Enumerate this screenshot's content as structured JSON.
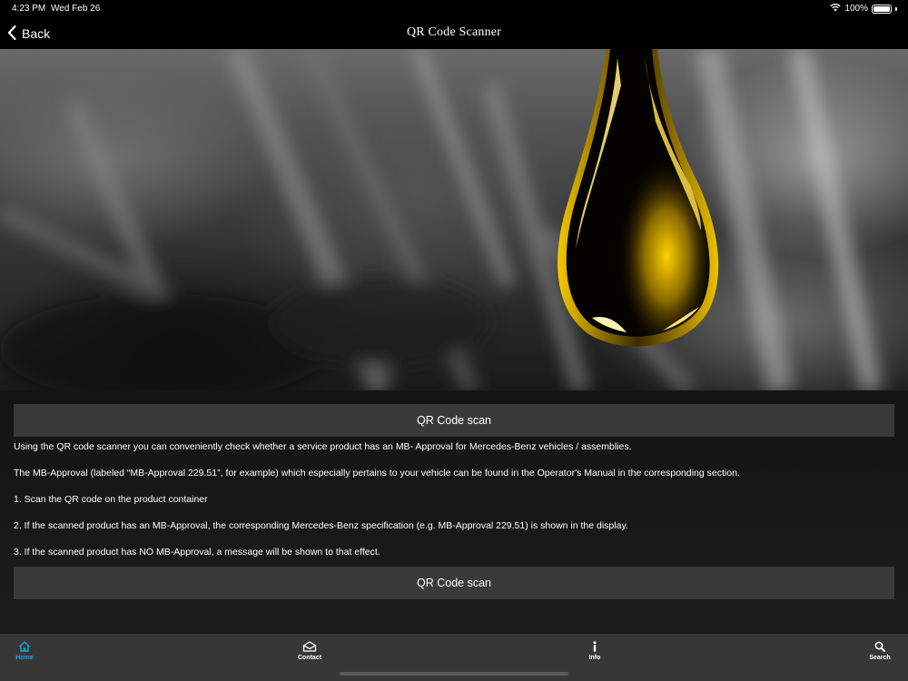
{
  "status": {
    "time": "4:23 PM",
    "date": "Wed Feb 26",
    "battery": "100%"
  },
  "nav": {
    "back_label": "Back",
    "title": "QR Code Scanner"
  },
  "content": {
    "scan_button_top": "QR Code scan",
    "paragraphs": [
      "Using the QR code scanner you can conveniently check whether a service product has an MB- Approval for Mercedes-Benz vehicles / assemblies.",
      "The MB-Approval (labeled “MB-Approval 229.51”, for example) which especially pertains to your vehicle can be found in the Operator's Manual in the corresponding section.",
      "1. Scan the QR code on the product container",
      "2. If the scanned product has an MB-Approval, the corresponding Mercedes-Benz specification (e.g. MB-Approval 229.51) is shown in the display.",
      "3. If the scanned product has NO MB-Approval, a message will be shown to that effect."
    ],
    "scan_button_bottom": "QR Code scan"
  },
  "tabs": [
    {
      "label": "Home",
      "icon": "home-icon"
    },
    {
      "label": "Contact",
      "icon": "envelope-icon"
    },
    {
      "label": "Info",
      "icon": "info-icon"
    },
    {
      "label": "Search",
      "icon": "search-icon"
    }
  ],
  "colors": {
    "accent": "#1aa0e0",
    "button_bg": "#3a3a3a",
    "tab_bar_bg": "#373737",
    "oil_gold": "#f2c200"
  }
}
